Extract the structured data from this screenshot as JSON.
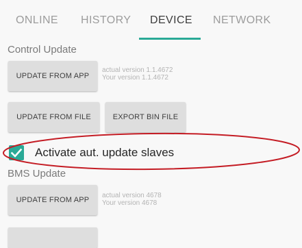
{
  "tabs": [
    {
      "label": "ONLINE",
      "active": false
    },
    {
      "label": "HISTORY",
      "active": false
    },
    {
      "label": "DEVICE",
      "active": true
    },
    {
      "label": "NETWORK",
      "active": false
    }
  ],
  "control_update": {
    "title": "Control Update",
    "update_from_app": "UPDATE FROM APP",
    "actual_version": "actual version 1.1.4672",
    "your_version": "Your version 1.1.4672",
    "update_from_file": "UPDATE FROM FILE",
    "export_bin_file": "EXPORT BIN FILE",
    "auto_update_slaves": {
      "label": "Activate aut. update slaves",
      "checked": true
    }
  },
  "bms_update": {
    "title": "BMS Update",
    "update_from_app": "UPDATE FROM APP",
    "actual_version": "actual version 4678",
    "your_version": "Your version 4678"
  },
  "colors": {
    "accent": "#2aa996",
    "annotation": "#c41c24",
    "button_bg": "#dedede",
    "background": "#f8f8f8"
  },
  "icons": {
    "checkbox": "checkmark-icon"
  }
}
